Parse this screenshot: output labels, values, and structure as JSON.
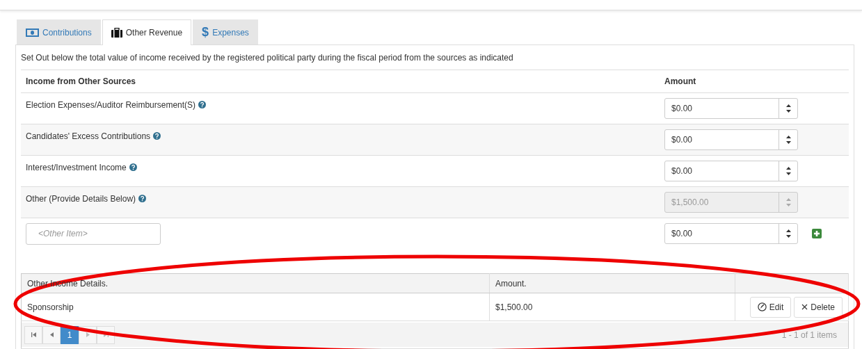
{
  "tabs": [
    {
      "label": "Contributions",
      "selected": false
    },
    {
      "label": "Other Revenue",
      "selected": true
    },
    {
      "label": "Expenses",
      "selected": false,
      "icon_text": "$"
    }
  ],
  "description": "Set Out below the total value of income received by the registered political party during the fiscal period from the sources as indicated",
  "income_table": {
    "columns": [
      "Income from Other Sources",
      "Amount"
    ],
    "rows": [
      {
        "kind": "fixed",
        "label": "Election Expenses/Auditor Reimbursement(S)",
        "amount": "$0.00",
        "disabled": false
      },
      {
        "kind": "fixed",
        "label": "Candidates' Excess Contributions",
        "amount": "$0.00",
        "disabled": false
      },
      {
        "kind": "fixed",
        "label": "Interest/Investment Income",
        "amount": "$0.00",
        "disabled": false
      },
      {
        "kind": "fixed",
        "label": "Other (Provide Details Below)",
        "amount": "$1,500.00",
        "disabled": true
      },
      {
        "kind": "custom",
        "placeholder": "<Other Item>",
        "amount": "$0.00",
        "disabled": false
      }
    ]
  },
  "details_table": {
    "columns": [
      "Other Income Details.",
      "Amount."
    ],
    "rows": [
      {
        "detail": "Sponsorship",
        "amount": "$1,500.00",
        "actions": [
          "Edit",
          "Delete"
        ]
      }
    ],
    "pager": {
      "pages": [
        {
          "label": "1",
          "selected": true
        }
      ],
      "summary": "1 - 1 of 1 items"
    }
  }
}
